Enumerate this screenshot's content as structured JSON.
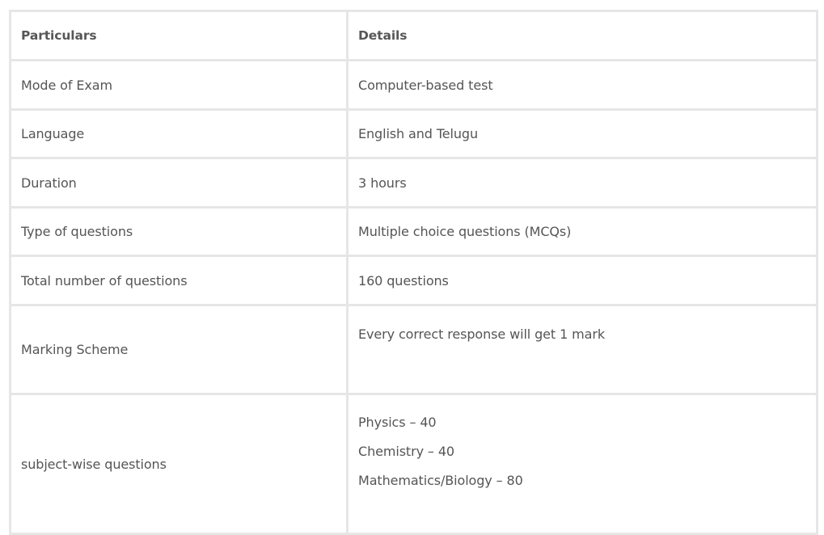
{
  "table": {
    "headers": [
      "Particulars",
      "Details"
    ],
    "rows": [
      {
        "label": "Mode of Exam",
        "value": "Computer-based test"
      },
      {
        "label": "Language",
        "value": "English and Telugu"
      },
      {
        "label": "Duration",
        "value": "3 hours"
      },
      {
        "label": "Type of questions",
        "value": "Multiple choice questions (MCQs)"
      },
      {
        "label": "Total number of questions",
        "value": "160 questions"
      },
      {
        "label": "Marking Scheme",
        "value": "Every correct response will get 1 mark"
      },
      {
        "label": "subject-wise questions",
        "values": [
          "Physics – 40",
          "Chemistry – 40",
          "Mathematics/Biology – 80"
        ]
      }
    ]
  }
}
